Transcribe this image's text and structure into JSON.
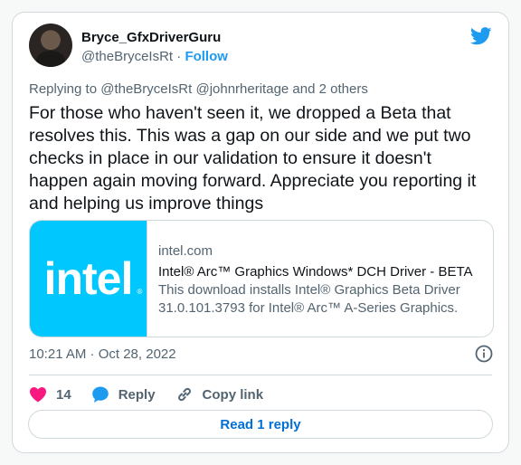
{
  "author": {
    "display_name": "Bryce_GfxDriverGuru",
    "handle": "@theBryceIsRt",
    "separator": "·",
    "follow_label": "Follow"
  },
  "reply_context": "Replying to @theBryceIsRt @johnrheritage and 2 others",
  "tweet_text": "For those who haven't seen it, we dropped a Beta that resolves this. This was a gap on our side and we put two checks in place in our validation to ensure it doesn't happen again moving forward. Appreciate you reporting it and helping us improve things",
  "link_card": {
    "logo_text": "intel",
    "logo_reg": "®",
    "domain": "intel.com",
    "title": "Intel® Arc™ Graphics Windows* DCH Driver - BETA",
    "description": "This download installs Intel® Graphics Beta Driver 31.0.101.3793 for Intel® Arc™ A-Series Graphics."
  },
  "timestamp": "10:21 AM · Oct 28, 2022",
  "actions": {
    "like_count": "14",
    "reply_label": "Reply",
    "copy_link_label": "Copy link"
  },
  "read_reply_label": "Read 1 reply",
  "colors": {
    "twitter_blue": "#1d9bf0",
    "like_pink": "#f91880",
    "intel_blue": "#00c7fd"
  },
  "icons": [
    "twitter-bird-icon",
    "info-icon",
    "heart-icon",
    "reply-bubble-icon",
    "link-icon"
  ]
}
